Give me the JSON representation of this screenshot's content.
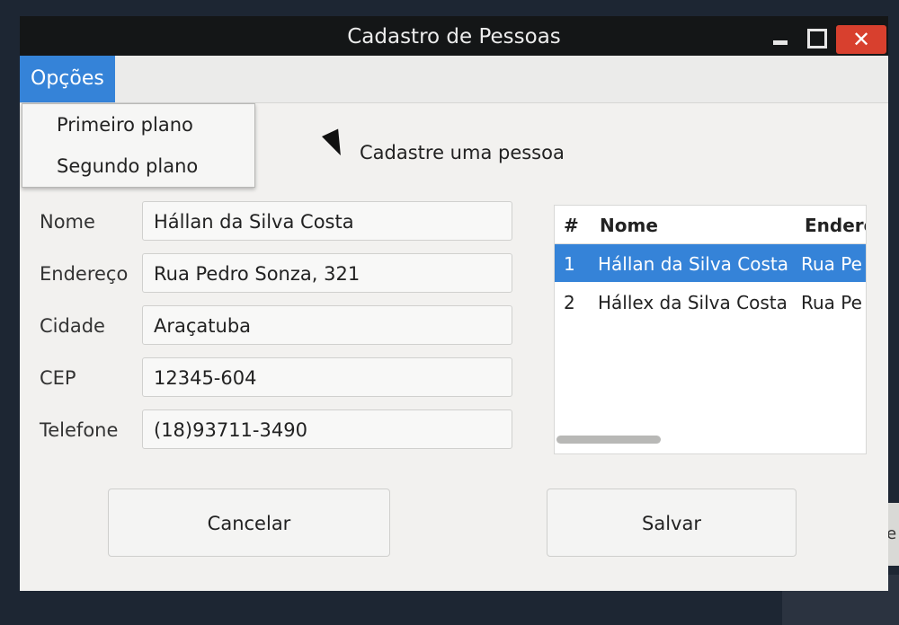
{
  "window": {
    "title": "Cadastro de Pessoas",
    "close_glyph": "✕"
  },
  "menu": {
    "label": "Opções",
    "items": [
      {
        "label": "Primeiro plano"
      },
      {
        "label": "Segundo plano"
      }
    ]
  },
  "header": {
    "label": "Cadastre uma pessoa"
  },
  "form": {
    "nome": {
      "label": "Nome",
      "value": "Hállan da Silva Costa"
    },
    "endereco": {
      "label": "Endereço",
      "value": "Rua Pedro Sonza, 321"
    },
    "cidade": {
      "label": "Cidade",
      "value": "Araçatuba"
    },
    "cep": {
      "label": "CEP",
      "value": "12345-604"
    },
    "telefone": {
      "label": "Telefone",
      "value": "(18)93711-3490"
    }
  },
  "table": {
    "columns": [
      "#",
      "Nome",
      "Endere"
    ],
    "rows": [
      {
        "num": "1",
        "nome": "Hállan da Silva Costa",
        "endereco": "Rua Pe",
        "selected": true
      },
      {
        "num": "2",
        "nome": "Hállex da Silva Costa",
        "endereco": "Rua Pe",
        "selected": false
      }
    ]
  },
  "buttons": {
    "cancel": "Cancelar",
    "save": "Salvar"
  },
  "background": {
    "partial_text": "e Fe"
  },
  "colors": {
    "accent": "#3583d8",
    "close": "#d8402e",
    "titlebar": "#141617"
  }
}
